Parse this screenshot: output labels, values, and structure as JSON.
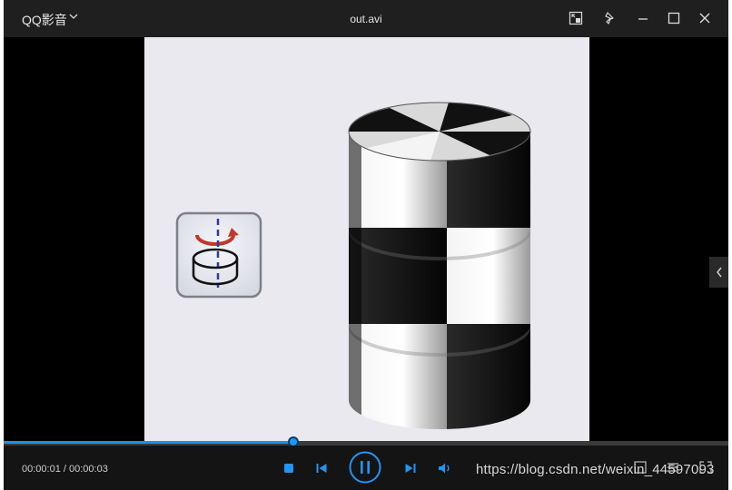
{
  "app": {
    "name": "QQ影音"
  },
  "window": {
    "title": "out.avi"
  },
  "player": {
    "time_display": "00:00:01 / 00:00:03",
    "progress_fraction": 0.4
  },
  "watermark": "https://blog.csdn.net/weixin_44597093",
  "colors": {
    "accent": "#2196f3",
    "titlebar": "#1f1f1f",
    "controls_bg": "#141414"
  },
  "icons": [
    "chevron-down-icon",
    "mini-mode-icon",
    "pin-icon",
    "minimize-icon",
    "maximize-icon",
    "close-icon",
    "stop-icon",
    "previous-icon",
    "pause-icon",
    "next-icon",
    "volume-icon",
    "side-panel-toggle-icon"
  ]
}
